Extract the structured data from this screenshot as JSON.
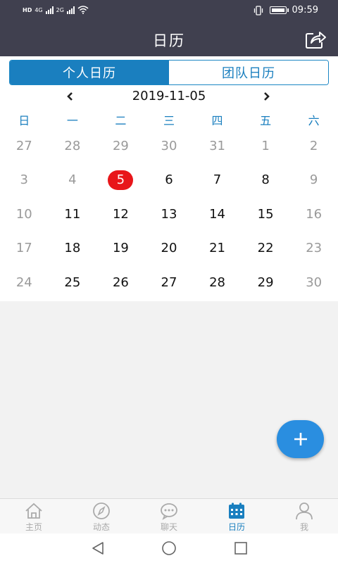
{
  "status_bar": {
    "left_badges": [
      "HD",
      "4G",
      "2G"
    ],
    "time": "09:59"
  },
  "header": {
    "title": "日历",
    "share_icon": "share-icon"
  },
  "segments": [
    {
      "label": "个人日历",
      "active": true
    },
    {
      "label": "团队日历",
      "active": false
    }
  ],
  "calendar": {
    "current_date": "2019-11-05",
    "weekdays": [
      "日",
      "一",
      "二",
      "三",
      "四",
      "五",
      "六"
    ],
    "weeks": [
      [
        {
          "d": "27",
          "m": true
        },
        {
          "d": "28",
          "m": true
        },
        {
          "d": "29",
          "m": true
        },
        {
          "d": "30",
          "m": true
        },
        {
          "d": "31",
          "m": true
        },
        {
          "d": "1",
          "m": true
        },
        {
          "d": "2",
          "m": true
        }
      ],
      [
        {
          "d": "3",
          "m": true
        },
        {
          "d": "4",
          "m": true
        },
        {
          "d": "5",
          "m": false,
          "today": true
        },
        {
          "d": "6",
          "m": false
        },
        {
          "d": "7",
          "m": false
        },
        {
          "d": "8",
          "m": false
        },
        {
          "d": "9",
          "m": true
        }
      ],
      [
        {
          "d": "10",
          "m": true
        },
        {
          "d": "11",
          "m": false
        },
        {
          "d": "12",
          "m": false
        },
        {
          "d": "13",
          "m": false
        },
        {
          "d": "14",
          "m": false
        },
        {
          "d": "15",
          "m": false
        },
        {
          "d": "16",
          "m": true
        }
      ],
      [
        {
          "d": "17",
          "m": true
        },
        {
          "d": "18",
          "m": false
        },
        {
          "d": "19",
          "m": false
        },
        {
          "d": "20",
          "m": false
        },
        {
          "d": "21",
          "m": false
        },
        {
          "d": "22",
          "m": false
        },
        {
          "d": "23",
          "m": true
        }
      ],
      [
        {
          "d": "24",
          "m": true
        },
        {
          "d": "25",
          "m": false
        },
        {
          "d": "26",
          "m": false
        },
        {
          "d": "27",
          "m": false
        },
        {
          "d": "28",
          "m": false
        },
        {
          "d": "29",
          "m": false
        },
        {
          "d": "30",
          "m": true
        }
      ]
    ]
  },
  "fab": {
    "icon": "plus-icon"
  },
  "tabs": [
    {
      "label": "主页",
      "icon": "home-icon",
      "active": false
    },
    {
      "label": "动态",
      "icon": "compass-icon",
      "active": false
    },
    {
      "label": "聊天",
      "icon": "chat-icon",
      "active": false
    },
    {
      "label": "日历",
      "icon": "calendar-icon",
      "active": true
    },
    {
      "label": "我",
      "icon": "person-icon",
      "active": false
    }
  ],
  "colors": {
    "header_bg": "#40404f",
    "accent": "#1a7fbf",
    "today": "#e8161a",
    "fab": "#2a8ee0"
  }
}
